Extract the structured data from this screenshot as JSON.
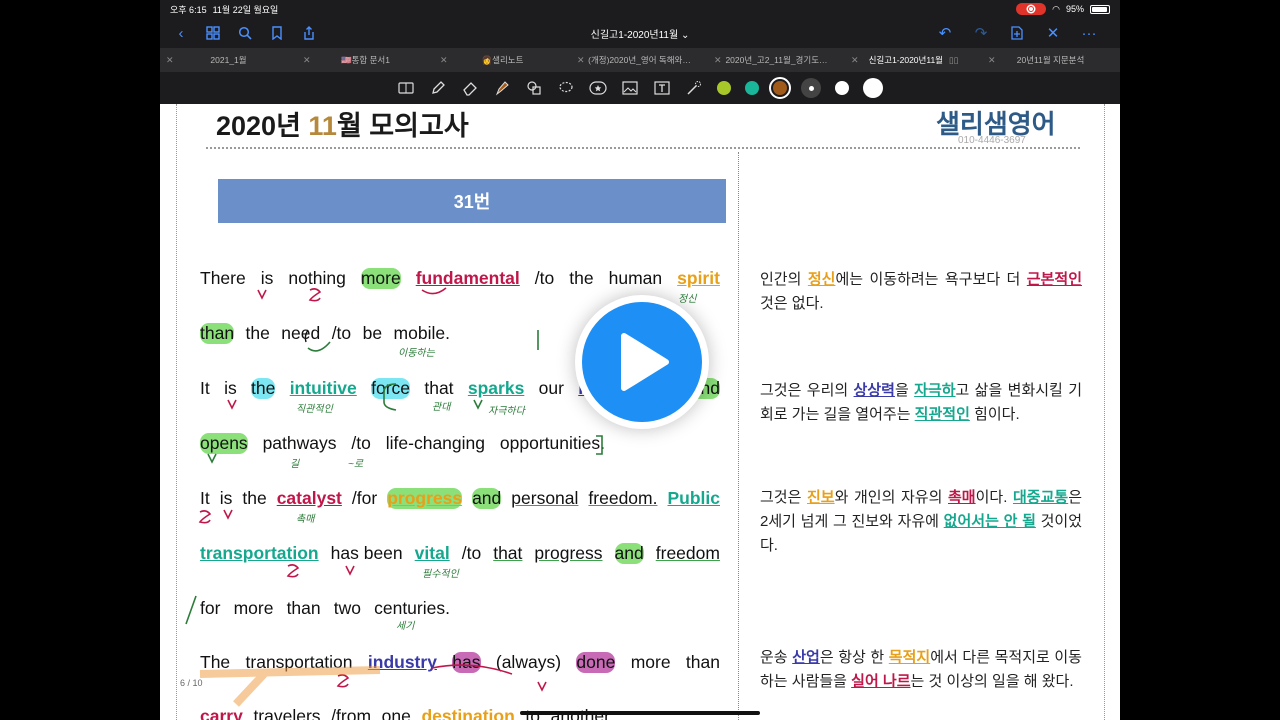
{
  "status": {
    "time": "오후 6:15",
    "date": "11월 22일 월요일",
    "battery": "95%",
    "battery_level": 0.95
  },
  "nav": {
    "title": "신길고1-2020년11월 ⌄"
  },
  "tabs": [
    {
      "label": "2021_1월",
      "active": false
    },
    {
      "label": "🇺🇸통합 문서1",
      "active": false
    },
    {
      "label": "👩샐리노트",
      "active": false
    },
    {
      "label": "(개정)2020년_영어 독해와…",
      "active": false
    },
    {
      "label": "2020년_고2_11월_경기도…",
      "active": false
    },
    {
      "label": "신길고1-2020년11월",
      "active": true
    },
    {
      "label": "20년11월 지문분석",
      "active": false
    }
  ],
  "toolbar": {
    "tools": [
      "read-mode-icon",
      "pen-icon",
      "eraser-icon",
      "highlighter-icon",
      "shapes-icon",
      "lasso-icon",
      "sticker-icon",
      "image-icon",
      "text-icon",
      "laser-icon"
    ],
    "colors": [
      "#a8c82a",
      "#19b69a",
      "#a05a1a"
    ],
    "selected_color": "#a05a1a"
  },
  "doc": {
    "title_pre": "2020년 ",
    "title_month": "11",
    "title_post": "월  모의고사",
    "brand": "샐리샘영어",
    "phone": "010-4446-3697",
    "question": "31번",
    "page_indicator": "6 / 10"
  },
  "eng": {
    "l1": [
      "There",
      "is",
      "nothing",
      "more",
      "fundamental",
      "/to",
      "the",
      "human",
      "spirit"
    ],
    "l2": [
      "than",
      "the",
      "need",
      "/to",
      "be",
      "mobile."
    ],
    "l3": [
      "It",
      "is",
      "the",
      "intuitive",
      "force",
      "that",
      "sparks",
      "our",
      "imagination",
      "and"
    ],
    "l4": [
      "opens",
      "pathways",
      "/to",
      "life-changing",
      "opportunities."
    ],
    "l5": [
      "It",
      "is",
      "the",
      "catalyst",
      "/for",
      "progress",
      "and",
      "personal",
      "freedom.",
      "Public"
    ],
    "l6": [
      "transportation",
      "has been",
      "vital",
      "/to",
      "that",
      "progress",
      "and",
      "freedom"
    ],
    "l7": [
      "for",
      "more",
      "than",
      "two",
      "centuries."
    ],
    "l8": [
      "The",
      "transportation",
      "industry",
      "has",
      "(always)",
      "done",
      "more",
      "than"
    ],
    "l9": [
      "carry",
      "travelers",
      "/from",
      "one",
      "destination",
      "to",
      "another"
    ]
  },
  "notes": {
    "n1": "정신",
    "n2": "이동하는",
    "n3": "직관적인",
    "n4": "관대",
    "n5": "자극하다",
    "n6": "길",
    "n7": "~로",
    "n8": "촉매",
    "n9": "필수적인",
    "n10": "세기"
  },
  "kor": {
    "p1": {
      "a": "인간의 ",
      "b": "정신",
      "c": "에는 이동하려는 욕구보다 더 ",
      "d": "근본적인",
      "e": " 것은 없다."
    },
    "p2": {
      "a": "그것은 우리의 ",
      "b": "상상력",
      "c": "을 ",
      "d": "자극하",
      "e": "고 삶을 변화시킬 기회로 가는 길을 열어주는 ",
      "f": "직관적인",
      "g": " 힘이다."
    },
    "p3": {
      "a": "그것은 ",
      "b": "진보",
      "c": "와 개인의 자유의 ",
      "d": "촉매",
      "e": "이다. ",
      "f": "대중교통",
      "g": "은 2세기 넘게 그 진보와 자유에 ",
      "h": "없어서는 안 될",
      "i": " 것이었다."
    },
    "p4": {
      "a": "운송 ",
      "b": "산업",
      "c": "은 항상 한 ",
      "d": "목적지",
      "e": "에서 다른 목적지로 이동하는 사람들을 ",
      "f": "실어 나르",
      "g": "는 것 이상의 일을 해 왔다."
    }
  }
}
